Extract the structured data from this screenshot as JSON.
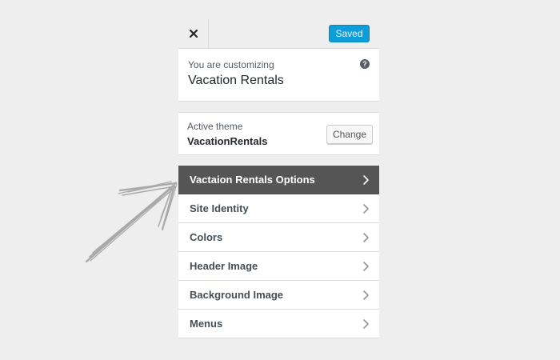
{
  "topbar": {
    "close_icon": "close-icon",
    "saved_label": "Saved",
    "accent": "#0d9ed9"
  },
  "customize": {
    "subtitle": "You are customizing",
    "site_title": "Vacation Rentals",
    "help_icon": "help-icon",
    "help_glyph": "?"
  },
  "theme": {
    "label": "Active theme",
    "name": "VacationRentals",
    "change_label": "Change"
  },
  "menu": {
    "items": [
      {
        "label": "Vactaion Rentals Options",
        "active": true
      },
      {
        "label": "Site Identity",
        "active": false
      },
      {
        "label": "Colors",
        "active": false
      },
      {
        "label": "Header Image",
        "active": false
      },
      {
        "label": "Background Image",
        "active": false
      },
      {
        "label": "Menus",
        "active": false
      }
    ],
    "active_color": "#555555",
    "chevron_icon": "chevron-right-icon"
  },
  "annotation": {
    "icon": "hand-drawn-arrow-icon",
    "color": "#a9a9a9"
  }
}
